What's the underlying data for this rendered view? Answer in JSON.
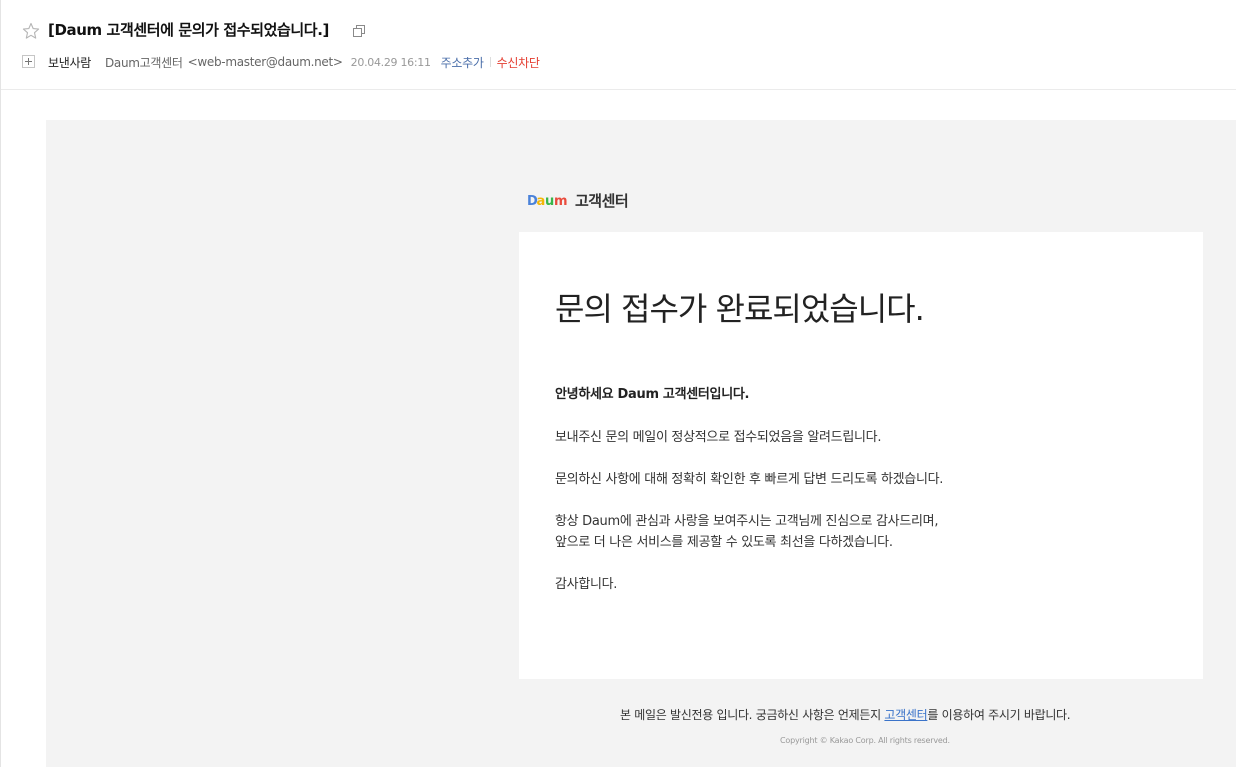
{
  "header": {
    "subject": "[Daum 고객센터에 문의가 접수되었습니다.]",
    "sender_label": "보낸사람",
    "sender_name": "Daum고객센터",
    "sender_email": "<web-master@daum.net>",
    "date": "20.04.29 16:11",
    "add_address": "주소추가",
    "block_sender": "수신차단"
  },
  "body": {
    "logo_text": "고객센터",
    "title": "문의 접수가 완료되었습니다.",
    "greeting": "안녕하세요 Daum 고객센터입니다.",
    "paragraphs": [
      "보내주신 문의 메일이 정상적으로 접수되었음을 알려드립니다.",
      "문의하신 사항에 대해 정확히 확인한 후 빠르게 답변 드리도록 하겠습니다.",
      "항상 Daum에 관심과 사랑을 보여주시는 고객님께 진심으로 감사드리며,",
      "앞으로 더 나은 서비스를 제공할 수 있도록 최선을 다하겠습니다.",
      "감사합니다."
    ],
    "footer": {
      "notice_before": "본 메일은 발신전용 입니다. 궁금하신 사항은 언제든지 ",
      "notice_link": "고객센터",
      "notice_after": "를 이용하여 주시기 바랍니다.",
      "copyright": "Copyright © Kakao Corp. All rights reserved."
    }
  },
  "colors": {
    "link_blue": "#3a73c9",
    "block_red": "#e43d30",
    "body_background": "#f3f3f3",
    "daum_d": "#4a82d9",
    "daum_a": "#f2b707",
    "daum_u": "#39b54a",
    "daum_m": "#e94b3c"
  },
  "icons": {
    "star": "star-icon",
    "copy": "copy-icon",
    "expand": "plus-icon",
    "logo": "daum-logo"
  }
}
